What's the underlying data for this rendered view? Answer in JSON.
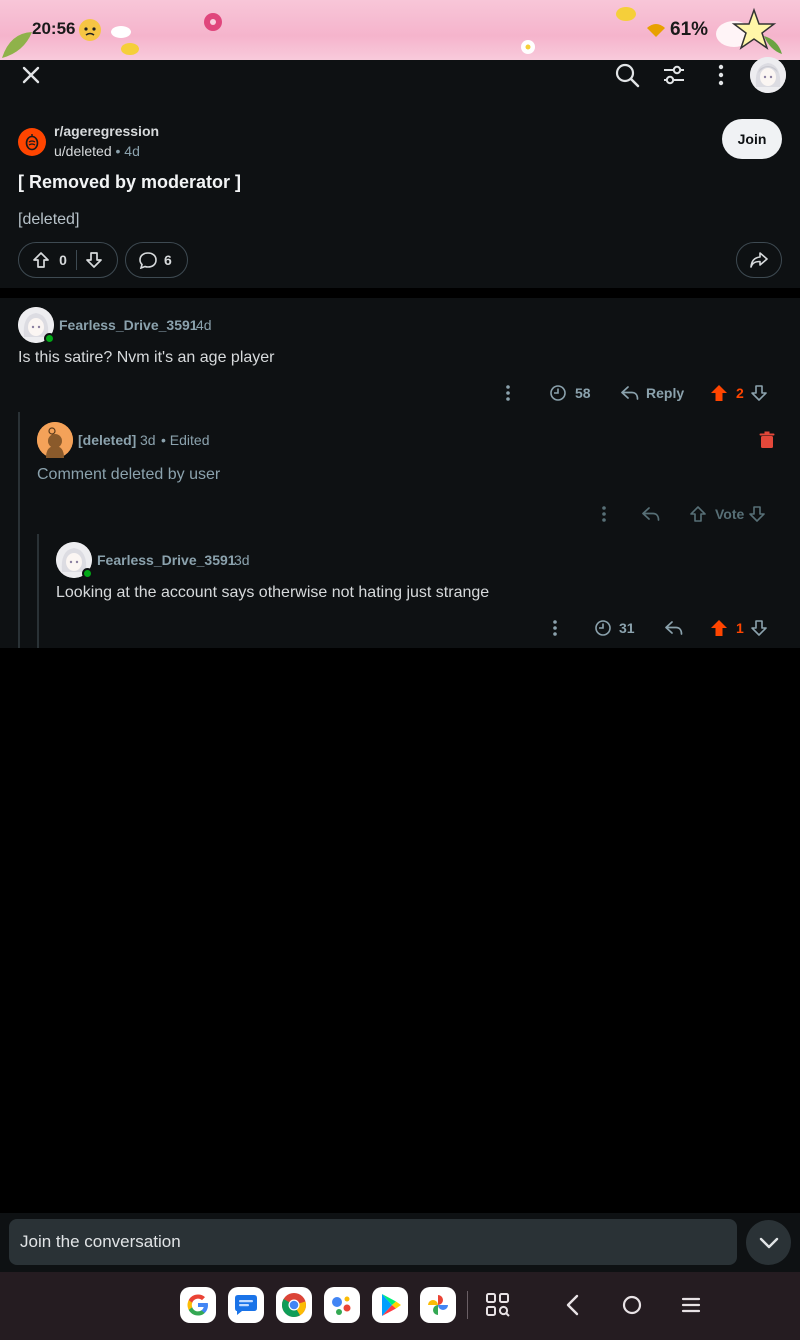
{
  "status_bar": {
    "time": "20:56",
    "battery": "61%"
  },
  "app_bar": {
    "close_icon": "close-icon",
    "search_icon": "search-icon",
    "filter_icon": "filter-icon",
    "more_icon": "more-vertical-icon"
  },
  "post": {
    "subreddit": "r/ageregression",
    "author": "u/deleted",
    "age": "4d",
    "join_label": "Join",
    "title": "[ Removed by moderator ]",
    "body": "[deleted]",
    "score": "0",
    "comment_count": "6"
  },
  "comments": [
    {
      "user": "Fearless_Drive_3591",
      "age": "4d",
      "body": "Is this satire? Nvm it's an age player",
      "awards": "58",
      "reply_label": "Reply",
      "score": "2"
    },
    {
      "user": "[deleted]",
      "age": "3d",
      "edited": "• Edited",
      "body": "Comment deleted by user",
      "vote_label": "Vote"
    },
    {
      "user": "Fearless_Drive_3591",
      "age": "3d",
      "body": "Looking at the account says otherwise not hating just strange",
      "awards": "31",
      "score": "1"
    }
  ],
  "composer": {
    "placeholder": "Join the conversation"
  },
  "colors": {
    "accent": "#ff4500",
    "online": "#01a816",
    "background": "#0e1113"
  }
}
